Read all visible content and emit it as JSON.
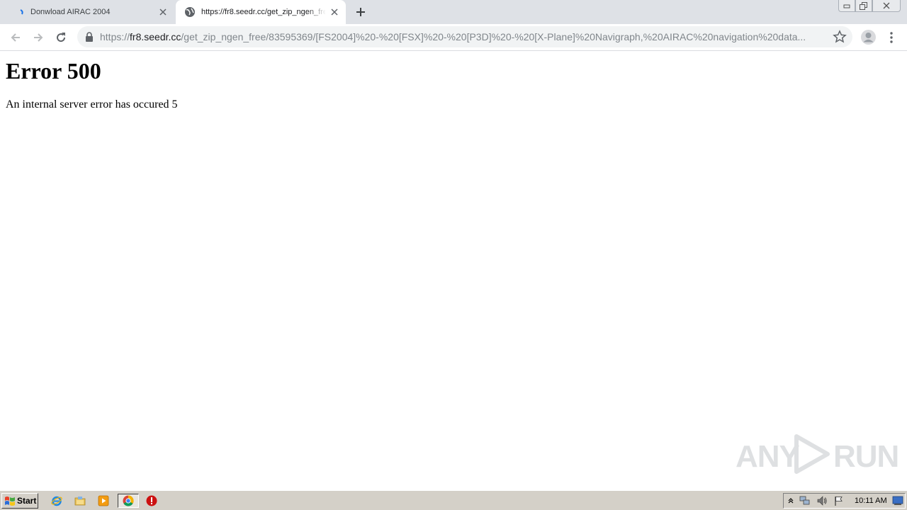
{
  "browser": {
    "tabs": [
      {
        "title": "Donwload AIRAC 2004",
        "active": false
      },
      {
        "title": "https://fr8.seedr.cc/get_zip_ngen_free/83595369/[FS2004]%20-%20[FSX]%20-%20[P3D]%20-%20[X-Plane]%20Navigraph,%20AIRAC%20navigation%20data",
        "active": true
      }
    ],
    "address_bar": {
      "scheme": "https://",
      "host": "fr8.seedr.cc",
      "path": "/get_zip_ngen_free/83595369/[FS2004]%20-%20[FSX]%20-%20[P3D]%20-%20[X-Plane]%20Navigraph,%20AIRAC%20navigation%20data..."
    }
  },
  "page": {
    "heading": "Error 500",
    "message": "An internal server error has occured 5",
    "watermark": "ANY RUN"
  },
  "taskbar": {
    "start_label": "Start",
    "clock": "10:11 AM",
    "pinned_icons": [
      "internet-explorer-icon",
      "file-explorer-icon",
      "media-player-icon",
      "chrome-icon",
      "stop-icon"
    ]
  },
  "colors": {
    "tabstrip": "#dee1e6",
    "omnibox": "#f1f3f4",
    "taskbar": "#d4d0c8",
    "stop_red": "#cc1111"
  }
}
